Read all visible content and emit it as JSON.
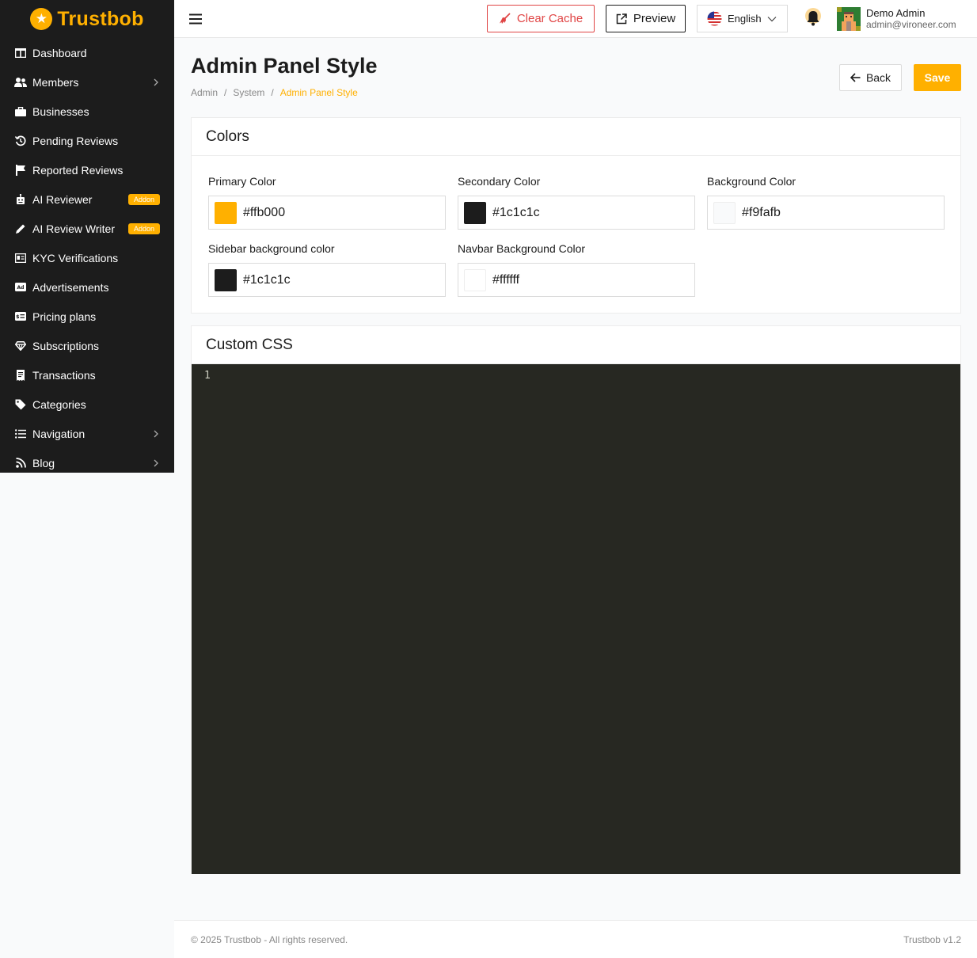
{
  "brand": {
    "name": "Trustbob",
    "color": "#ffb000"
  },
  "sidebar": {
    "items": [
      {
        "label": "Dashboard",
        "icon": "dashboard-icon",
        "chevron": false
      },
      {
        "label": "Members",
        "icon": "users-icon",
        "chevron": true
      },
      {
        "label": "Businesses",
        "icon": "briefcase-icon",
        "chevron": false
      },
      {
        "label": "Pending Reviews",
        "icon": "history-icon",
        "chevron": false
      },
      {
        "label": "Reported Reviews",
        "icon": "flag-icon",
        "chevron": false
      },
      {
        "label": "AI Reviewer",
        "icon": "robot-icon",
        "badge": "Addon"
      },
      {
        "label": "AI Review Writer",
        "icon": "pen-icon",
        "badge": "Addon"
      },
      {
        "label": "KYC Verifications",
        "icon": "id-card-icon",
        "chevron": false
      },
      {
        "label": "Advertisements",
        "icon": "ad-icon",
        "chevron": false
      },
      {
        "label": "Pricing plans",
        "icon": "pricing-icon",
        "chevron": false
      },
      {
        "label": "Subscriptions",
        "icon": "gem-icon",
        "chevron": false
      },
      {
        "label": "Transactions",
        "icon": "receipt-icon",
        "chevron": false
      },
      {
        "label": "Categories",
        "icon": "tags-icon",
        "chevron": false
      },
      {
        "label": "Navigation",
        "icon": "list-icon",
        "chevron": true
      },
      {
        "label": "Blog",
        "icon": "rss-icon",
        "chevron": true
      }
    ]
  },
  "navbar": {
    "clear_cache": "Clear Cache",
    "preview": "Preview",
    "language": "English",
    "user_name": "Demo Admin",
    "user_email": "admin@vironeer.com"
  },
  "header": {
    "title": "Admin Panel Style",
    "breadcrumb": [
      "Admin",
      "System",
      "Admin Panel Style"
    ],
    "back": "Back",
    "save": "Save"
  },
  "colors_card": {
    "title": "Colors",
    "fields": [
      {
        "label": "Primary Color",
        "value": "#ffb000"
      },
      {
        "label": "Secondary Color",
        "value": "#1c1c1c"
      },
      {
        "label": "Background Color",
        "value": "#f9fafb"
      },
      {
        "label": "Sidebar background color",
        "value": "#1c1c1c"
      },
      {
        "label": "Navbar Background Color",
        "value": "#ffffff"
      }
    ]
  },
  "css_card": {
    "title": "Custom CSS",
    "line_number": "1"
  },
  "footer": {
    "copyright": "© 2025 Trustbob - All rights reserved.",
    "version": "Trustbob v1.2"
  }
}
